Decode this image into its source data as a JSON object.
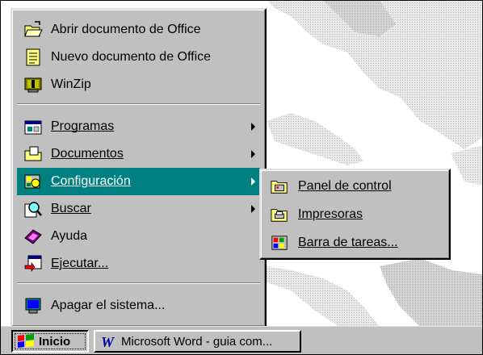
{
  "start_menu": {
    "top_items": [
      {
        "label": "Abrir documento de Office",
        "icon": "open-folder-icon"
      },
      {
        "label": "Nuevo documento de Office",
        "icon": "new-document-icon"
      },
      {
        "label": "WinZip",
        "icon": "winzip-icon"
      }
    ],
    "main_items": [
      {
        "label": "Programas",
        "icon": "programs-icon",
        "has_submenu": true
      },
      {
        "label": "Documentos",
        "icon": "documents-icon",
        "has_submenu": true
      },
      {
        "label": "Configuración",
        "icon": "settings-icon",
        "has_submenu": true,
        "selected": true
      },
      {
        "label": "Buscar",
        "icon": "find-icon",
        "has_submenu": true
      },
      {
        "label": "Ayuda",
        "icon": "help-icon",
        "has_submenu": false
      },
      {
        "label": "Ejecutar...",
        "icon": "run-icon",
        "has_submenu": false
      }
    ],
    "shutdown": {
      "label": "Apagar el sistema...",
      "icon": "shutdown-icon"
    }
  },
  "submenu": {
    "items": [
      {
        "label": "Panel de control",
        "icon": "control-panel-folder-icon"
      },
      {
        "label": "Impresoras",
        "icon": "printers-folder-icon"
      },
      {
        "label": "Barra de tareas...",
        "icon": "taskbar-icon"
      }
    ]
  },
  "taskbar": {
    "start_label": "Inicio",
    "task_label": "Microsoft Word - guia com..."
  },
  "colors": {
    "menu_bg": "#c0c0c0",
    "highlight": "#008080",
    "desktop": "#ffffff"
  }
}
